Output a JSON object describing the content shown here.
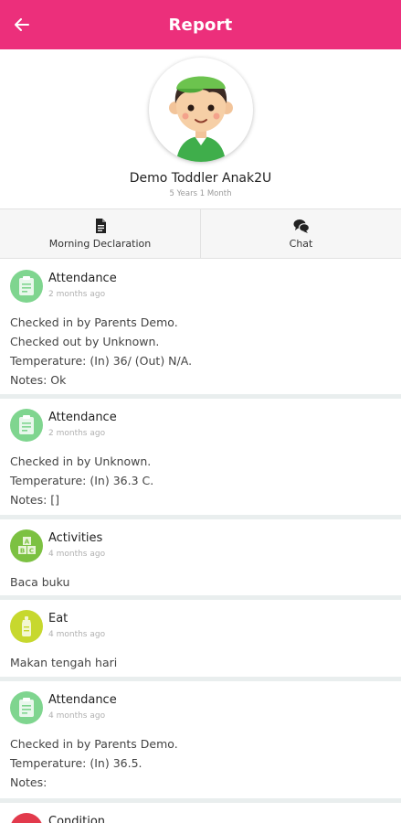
{
  "header": {
    "title": "Report",
    "back_icon": "arrow-left-icon"
  },
  "profile": {
    "name": "Demo Toddler Anak2U",
    "age": "5 Years 1 Month",
    "avatar_icon": "child-avatar-icon"
  },
  "tabs": [
    {
      "label": "Morning Declaration",
      "icon": "document-icon"
    },
    {
      "label": "Chat",
      "icon": "chat-bubbles-icon"
    }
  ],
  "feed": [
    {
      "title": "Attendance",
      "time": "2 months ago",
      "icon": "attendance-clipboard-icon",
      "color": "#7fd58f",
      "lines": [
        "Checked in by Parents Demo.",
        "Checked out by Unknown.",
        "Temperature: (In) 36/ (Out) N/A.",
        "Notes: Ok"
      ]
    },
    {
      "title": "Attendance",
      "time": "2 months ago",
      "icon": "attendance-clipboard-icon",
      "color": "#7fd58f",
      "lines": [
        "Checked in by Unknown.",
        "Temperature: (In) 36.3 C.",
        "Notes: []"
      ]
    },
    {
      "title": "Activities",
      "time": "4 months ago",
      "icon": "abc-blocks-icon",
      "color": "#7cc142",
      "lines": [
        "Baca buku"
      ]
    },
    {
      "title": "Eat",
      "time": "4 months ago",
      "icon": "bottle-icon",
      "color": "#c7d82e",
      "lines": [
        "Makan tengah hari"
      ]
    },
    {
      "title": "Attendance",
      "time": "4 months ago",
      "icon": "attendance-clipboard-icon",
      "color": "#7fd58f",
      "lines": [
        "Checked in by Parents Demo.",
        "Temperature: (In) 36.5.",
        "Notes:"
      ]
    },
    {
      "title": "Condition",
      "time": "",
      "icon": "condition-icon",
      "color": "#e23a4c",
      "lines": []
    }
  ],
  "colors": {
    "brand": "#ec2f7b",
    "divider": "#e9eeee"
  }
}
